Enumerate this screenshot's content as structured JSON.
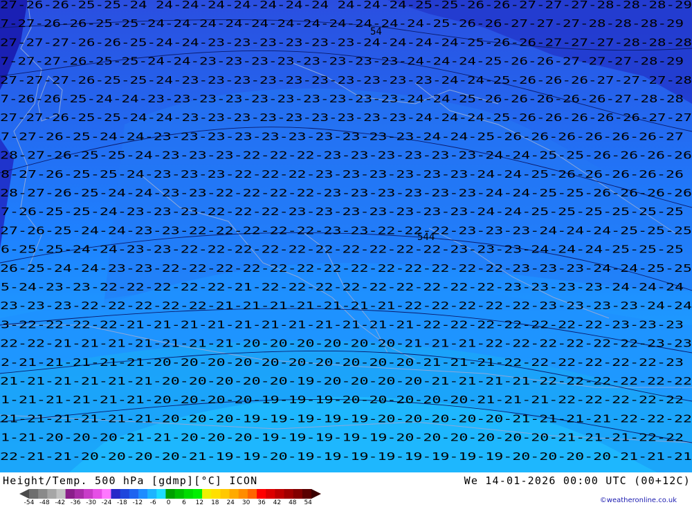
{
  "map": {
    "title": "Height/Temp. 500 hPa [gdmp][°C] ICON",
    "valid_time": "We 14-01-2026 00:00 UTC (00+12C)",
    "credit": "©weatheronline.co.uk",
    "contour_label_rows": [
      "27-26-26-25-25-24 24-24-24-24-24-24-24 24-24-24-25-25-26-26-27-27-27-28-28-28-29",
      "27-27-26-26-25-25-24-24-24-24-24-24-24-24-24-24-24-25-26-26-27-27-27-28-28-28-29",
      "27-27-27-26-26-25-24-24-23-23-23-23-23-23-24-24-24-24-25-26-26-27-27-27-28-28-28",
      "27-27-27-26-25-25-24-24-23-23-23-23-23-23-23-23-24-24-24-25-26-26-27-27-27-28-29",
      "27-27-27-26-25-25-24-23-23-23-23-23-23-23-23-23-23-24-24-25-26-26-26-27-27-27-28",
      "27-26-26-25-24-24-23-23-23-23-23-23-23-23-23-23-24-24-25-26-26-26-26-26-27-28-28",
      "27-27-26-25-25-24-24-23-23-23-23-23-23-23-23-23-24-24-24-25-26-26-26-26-26-27-27",
      "27-27-26-25-24-24-23-23-23-23-23-23-23-23-23-23-24-24-25-26-26-26-26-26-26-27",
      "28-27-26-25-25-24-23-23-23-22-22-22-23-23-23-23-23-23-24-24-25-25-26-26-26-26",
      "28-27-26-25-25-24-23-23-23-22-22-22-23-23-23-23-23-23-24-24-25-26-26-26-26-26",
      "28-27-26-25-24-24-23-23-22-22-22-22-23-23-23-23-23-23-24-24-25-25-26-26-26-26",
      "27-26-25-25-24-23-23-23-22-22-22-23-23-23-23-23-23-23-24-24-25-25-25-25-25-25",
      "27-26-25-24-24-23-23-22-22-22-22-22-23-23-22-22-22-23-23-23-24-24-24-25-25-25",
      "26-25-25-24-24-23-23-22-22-22-22-22-22-22-22-22-22-23-23-23-24-24-24-25-25-25",
      "26-25-24-24-23-23-22-22-22-22-22-22-22-22-22-22-22-22-22-23-23-23-24-24-25-25",
      "25-24-23-23-22-22-22-22-22-21-22-22-22-22-22-22-22-22-22-23-23-23-23-24-24-24",
      "23-23-23-22-22-22-22-22-21-21-21-21-21-21-21-22-22-22-22-22-23-23-23-23-24-24",
      "23-22-22-22-22-21-21-21-21-21-21-21-21-21-21-21-22-22-22-22-22-22-22-23-23-23",
      "22-22-21-21-21-21-21-21-21-20-20-20-20-20-20-21-21-21-22-22-22-22-22-22-23-23",
      "22-21-21-21-21-21-20-20-20-20-20-20-20-20-20-20-21-21-21-22-22-22-22-22-22-23",
      "21-21-21-21-21-21-20-20-20-20-20-19-20-20-20-20-21-21-21-21-22-22-22-22-22-22",
      "21-21-21-21-21-21-20-20-20-20-19-19-19-20-20-20-20-20-21-21-21-22-22-22-22-22",
      "21-21-21-21-21-21-20-20-20-19-19-19-19-19-20-20-20-20-20-21-21-21-21-22-22-22",
      "21-21-20-20-20-21-21-20-20-20-19-19-19-19-19-20-20-20-20-20-20-21-21-21-22-22",
      "22-21-21-20-20-20-20-21-19-19-20-19-19-19-19-19-19-19-19-20-20-20-20-21-21-21"
    ],
    "inline_marks": [
      "54",
      "544"
    ],
    "colors": {
      "sea_light": "#1fbfff",
      "band_21": "#1aa8f8",
      "band_22": "#1e90ff",
      "band_23": "#2478f4",
      "band_24": "#2a62ea",
      "band_25": "#2a4ee0",
      "band_27": "#1f34cc",
      "band_cold": "#1a20b4",
      "coastline": "#8ea8d8",
      "label": "#000000"
    }
  },
  "legend": {
    "scale_labels": [
      "-54",
      "-48",
      "-42",
      "-36",
      "-30",
      "-24",
      "-18",
      "-12",
      "-6",
      "0",
      "6",
      "12",
      "18",
      "24",
      "30",
      "36",
      "42",
      "48",
      "54"
    ],
    "swatches": [
      "#6e6e6e",
      "#8a8a8a",
      "#a6a6a6",
      "#c2c2c2",
      "#8a1e8a",
      "#a82ca8",
      "#c83cc8",
      "#e64fe6",
      "#ff78ff",
      "#2828c8",
      "#1e46dc",
      "#1e64f0",
      "#1e8cff",
      "#1eb4ff",
      "#1edcff",
      "#00a000",
      "#00be00",
      "#00dc00",
      "#00f000",
      "#f0f000",
      "#ffe000",
      "#ffc800",
      "#ffaa00",
      "#ff8c00",
      "#ff6400",
      "#ff0000",
      "#dc0000",
      "#be0000",
      "#a00000",
      "#820000",
      "#5a0000"
    ]
  }
}
